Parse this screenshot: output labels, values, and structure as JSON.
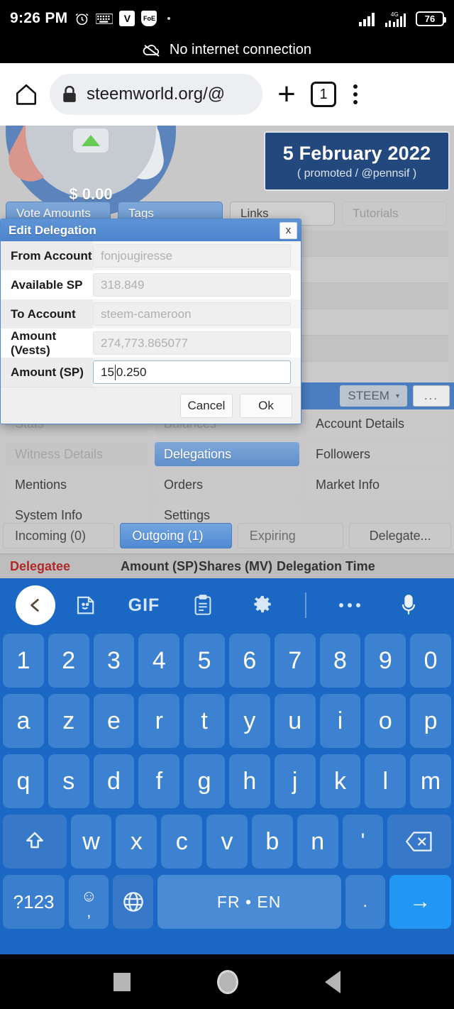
{
  "status_bar": {
    "time": "9:26 PM",
    "battery_percent": "76",
    "network_type": "4G",
    "icons": [
      "alarm-icon",
      "keyboard-icon",
      "vivaldi-badge-icon",
      "foe-badge-icon",
      "small-dot-icon",
      "wifi-signal-icon",
      "cellular-signal-icon",
      "battery-icon"
    ],
    "badge_v": "V",
    "badge_foe": "FoE"
  },
  "notification": {
    "text": "No internet connection",
    "icon": "cloud-off-icon"
  },
  "browser": {
    "home_icon": "home-icon",
    "lock_icon": "lock-icon",
    "url": "steemworld.org/@",
    "new_tab_label": "+",
    "tab_count": "1",
    "menu_icon": "overflow-menu-icon"
  },
  "page": {
    "gauge": {
      "value": "$ 0.00",
      "trend_icon": "triangle-up-icon"
    },
    "promo": {
      "date": "5 February 2022",
      "sub": "( promoted / @pennsif )"
    },
    "top_tabs": [
      {
        "label": "Vote Amounts",
        "state": "selected"
      },
      {
        "label": "Tags",
        "state": "selected"
      },
      {
        "label": "Links",
        "state": "plain"
      },
      {
        "label": "Tutorials",
        "state": "faint"
      }
    ],
    "steem_selector": {
      "label": "STEEM",
      "caret": "▾",
      "more_label": "..."
    },
    "nav_buttons": {
      "col1": [
        {
          "label": "Stats",
          "state": "faded"
        },
        {
          "label": "Witness Details",
          "state": "faded"
        },
        {
          "label": "Mentions",
          "state": "normal"
        },
        {
          "label": "System Info",
          "state": "normal"
        }
      ],
      "col2": [
        {
          "label": "Balances",
          "state": "faded"
        },
        {
          "label": "Delegations",
          "state": "selected"
        },
        {
          "label": "Orders",
          "state": "normal"
        },
        {
          "label": "Settings",
          "state": "normal"
        }
      ],
      "col3": [
        {
          "label": "Account Details",
          "state": "normal"
        },
        {
          "label": "Followers",
          "state": "normal"
        },
        {
          "label": "Market Info",
          "state": "normal"
        },
        {
          "label": "",
          "state": "empty"
        }
      ]
    },
    "sub_tabs": [
      {
        "label": "Incoming (0)",
        "state": "normal"
      },
      {
        "label": "Outgoing (1)",
        "state": "selected"
      },
      {
        "label": "Expiring",
        "state": "faint"
      },
      {
        "label": "Delegate...",
        "state": "normal"
      }
    ],
    "table_headers": [
      "Delegatee",
      "Amount (SP)",
      "Shares (MV)",
      "Delegation Time"
    ]
  },
  "dialog": {
    "title": "Edit Delegation",
    "close_label": "x",
    "rows": [
      {
        "label": "From Account",
        "value": "fonjougiresse",
        "readonly": true
      },
      {
        "label": "Available SP",
        "value": "318.849",
        "readonly": true
      },
      {
        "label": "To Account",
        "value": "steem-cameroon",
        "readonly": true
      },
      {
        "label": "Amount (Vests)",
        "value": "274,773.865077",
        "readonly": true
      },
      {
        "label": "Amount (SP)",
        "value": "150.250",
        "readonly": false
      }
    ],
    "amount_sp_before_caret": "15",
    "amount_sp_after_caret": "0.250",
    "cancel_label": "Cancel",
    "ok_label": "Ok"
  },
  "keyboard": {
    "toolbar": [
      "back-chevron-icon",
      "sticker-icon",
      "gif-icon",
      "clipboard-icon",
      "gear-icon",
      "divider",
      "more-dots-icon",
      "microphone-icon"
    ],
    "gif_label": "GIF",
    "row_numbers": [
      "1",
      "2",
      "3",
      "4",
      "5",
      "6",
      "7",
      "8",
      "9",
      "0"
    ],
    "row1": [
      "a",
      "z",
      "e",
      "r",
      "t",
      "y",
      "u",
      "i",
      "o",
      "p"
    ],
    "row2": [
      "q",
      "s",
      "d",
      "f",
      "g",
      "h",
      "j",
      "k",
      "l",
      "m"
    ],
    "row3_shift": "shift-icon",
    "row3": [
      "w",
      "x",
      "c",
      "v",
      "b",
      "n",
      "'"
    ],
    "row3_backspace": "backspace-icon",
    "row4": {
      "symbols_label": "?123",
      "emoji_label": "☺",
      "comma_label": ",",
      "globe_label": "globe-icon",
      "space_label": "FR • EN",
      "period_label": ".",
      "enter_label": "→"
    }
  },
  "nav_bar": {
    "recents": "square-icon",
    "home": "circle-home-icon",
    "back": "back-triangle-icon"
  },
  "colors": {
    "accent_blue": "#4f8ad4",
    "keyboard_blue": "#1a68c4",
    "promo_navy": "#22487d",
    "delegatee_red": "#b0292b",
    "enter_blue": "#2196f3"
  }
}
